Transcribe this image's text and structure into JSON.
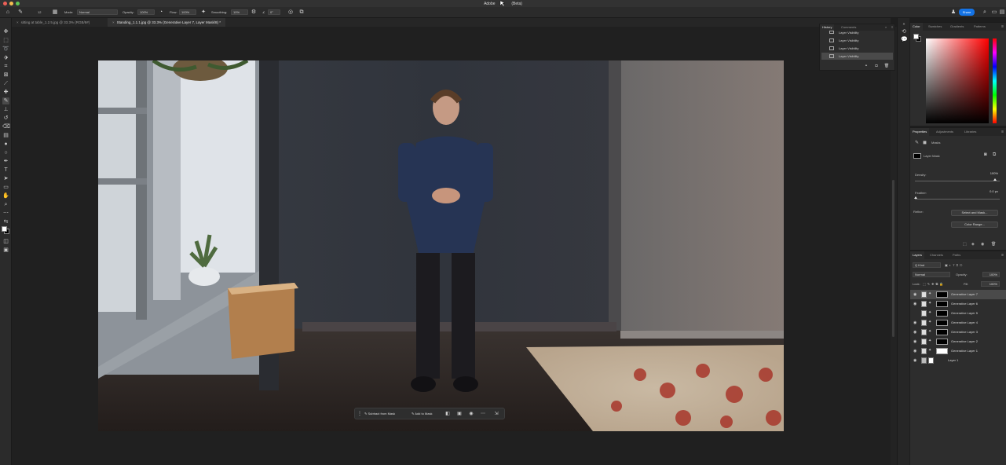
{
  "title": {
    "app": "Adobe",
    "beta": "(Beta)"
  },
  "options": {
    "mode_label": "Mode:",
    "mode_value": "Normal",
    "opacity_label": "Opacity:",
    "opacity_value": "100%",
    "flow_label": "Flow:",
    "flow_value": "100%",
    "smoothing_label": "Smoothing:",
    "smoothing_value": "10%",
    "angle_value": "0°",
    "brush_size": "12",
    "share_label": "Share"
  },
  "tabs": [
    {
      "label": "sitting at table_1.2.5.jpg @ 33.3% (RGB/8#)"
    },
    {
      "label": "Standing_1.1.1.jpg @ 33.3% (Generative Layer 7, Layer Mask/8) *"
    }
  ],
  "history": {
    "tabs": [
      "History",
      "Comments"
    ],
    "rows": [
      "Layer Visibility",
      "Layer Visibility",
      "Layer Visibility",
      "Layer Visibility"
    ]
  },
  "color_panel": {
    "tabs": [
      "Color",
      "Swatches",
      "Gradients",
      "Patterns"
    ],
    "foreground": "#ffffff",
    "background": "#000000"
  },
  "properties": {
    "tabs": [
      "Properties",
      "Adjustments",
      "Libraries"
    ],
    "masks_label": "Masks",
    "layer_mask_label": "Layer Mask",
    "density_label": "Density:",
    "density_value": "100%",
    "feather_label": "Feather:",
    "feather_value": "0.0 px",
    "refine_label": "Refine:",
    "select_and_mask": "Select and Mask...",
    "color_range": "Color Range..."
  },
  "layers_panel": {
    "tabs": [
      "Layers",
      "Channels",
      "Paths"
    ],
    "filter_kind": "Q Kind",
    "blend_mode": "Normal",
    "opacity_label": "Opacity:",
    "opacity_value": "100%",
    "lock_label": "Lock:",
    "fill_label": "Fill:",
    "fill_value": "100%",
    "layers": [
      {
        "name": "Generative Layer 7",
        "selected": true
      },
      {
        "name": "Generative Layer 6",
        "selected": false
      },
      {
        "name": "Generative Layer 5",
        "selected": false
      },
      {
        "name": "Generative Layer 4",
        "selected": false
      },
      {
        "name": "Generative Layer 3",
        "selected": false
      },
      {
        "name": "Generative Layer 2",
        "selected": false
      },
      {
        "name": "Generative Layer 1",
        "selected": false
      },
      {
        "name": "Layer 1",
        "selected": false
      }
    ]
  },
  "taskbar": {
    "subtract": "Subtract from Mask",
    "add": "Add to Mask"
  }
}
